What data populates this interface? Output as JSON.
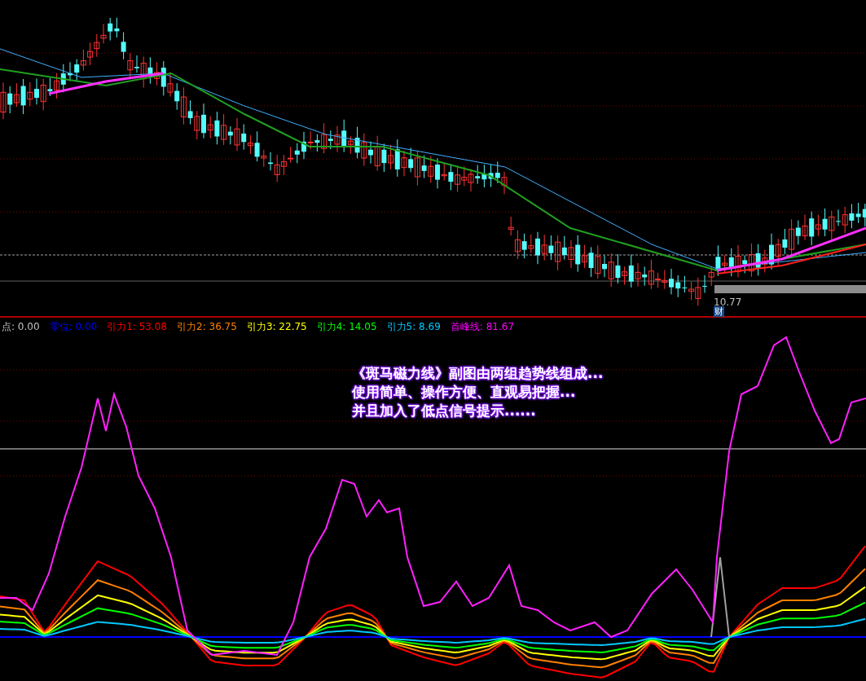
{
  "price_chart": {
    "price_label": "10.77",
    "badge": "财"
  },
  "legend": [
    {
      "text": "点: 0.00",
      "color": "#c0c0c0"
    },
    {
      "text": "零位: 0.00",
      "color": "#0000ff"
    },
    {
      "text": "引力1: 53.08",
      "color": "#ff0000"
    },
    {
      "text": "引力2: 36.75",
      "color": "#ff8000"
    },
    {
      "text": "引力3: 22.75",
      "color": "#ffff00"
    },
    {
      "text": "引力4: 14.05",
      "color": "#00ff00"
    },
    {
      "text": "引力5: 8.69",
      "color": "#00c8ff"
    },
    {
      "text": "首峰线: 81.67",
      "color": "#ff00ff"
    }
  ],
  "indicator": {
    "caption": [
      "《斑马磁力线》副图由两组趋势线组成...",
      "使用简单、操作方便、直观易把握...",
      "并且加入了低点信号提示......"
    ]
  }
}
